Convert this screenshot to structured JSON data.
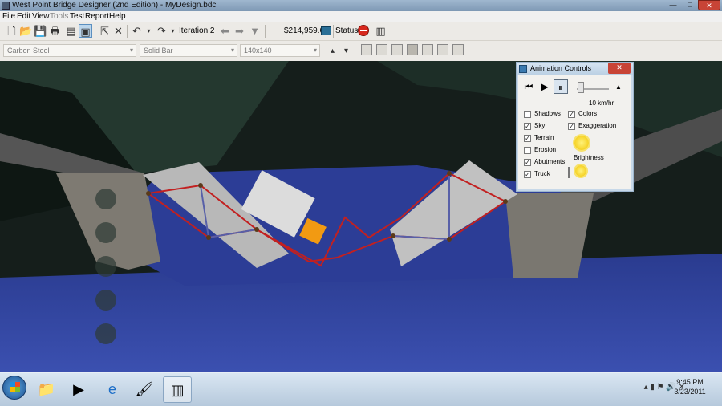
{
  "window": {
    "title": "West Point Bridge Designer (2nd Edition) - MyDesign.bdc"
  },
  "menu": [
    "File",
    "Edit",
    "View",
    "Tools",
    "Test",
    "Report",
    "Help"
  ],
  "toolbar": {
    "iteration": "Iteration 2",
    "cost": "$214,959.68",
    "status_label": "Status:",
    "status_icon": "fail-icon"
  },
  "properties": {
    "material": "Carbon Steel",
    "section": "Solid Bar",
    "size": "140x140"
  },
  "animation_controls": {
    "title": "Animation Controls",
    "close_label": "✕",
    "speed": "10 km/hr",
    "brightness_label": "Brightness",
    "options_left": [
      {
        "label": "Shadows",
        "checked": false
      },
      {
        "label": "Sky",
        "checked": true
      },
      {
        "label": "Terrain",
        "checked": true
      },
      {
        "label": "Erosion",
        "checked": false
      },
      {
        "label": "Abutments",
        "checked": true
      },
      {
        "label": "Truck",
        "checked": true
      }
    ],
    "options_right": [
      {
        "label": "Colors",
        "checked": true
      },
      {
        "label": "Exaggeration",
        "checked": true
      }
    ]
  },
  "taskbar": {
    "time": "9:45 PM",
    "date": "3/23/2011"
  }
}
